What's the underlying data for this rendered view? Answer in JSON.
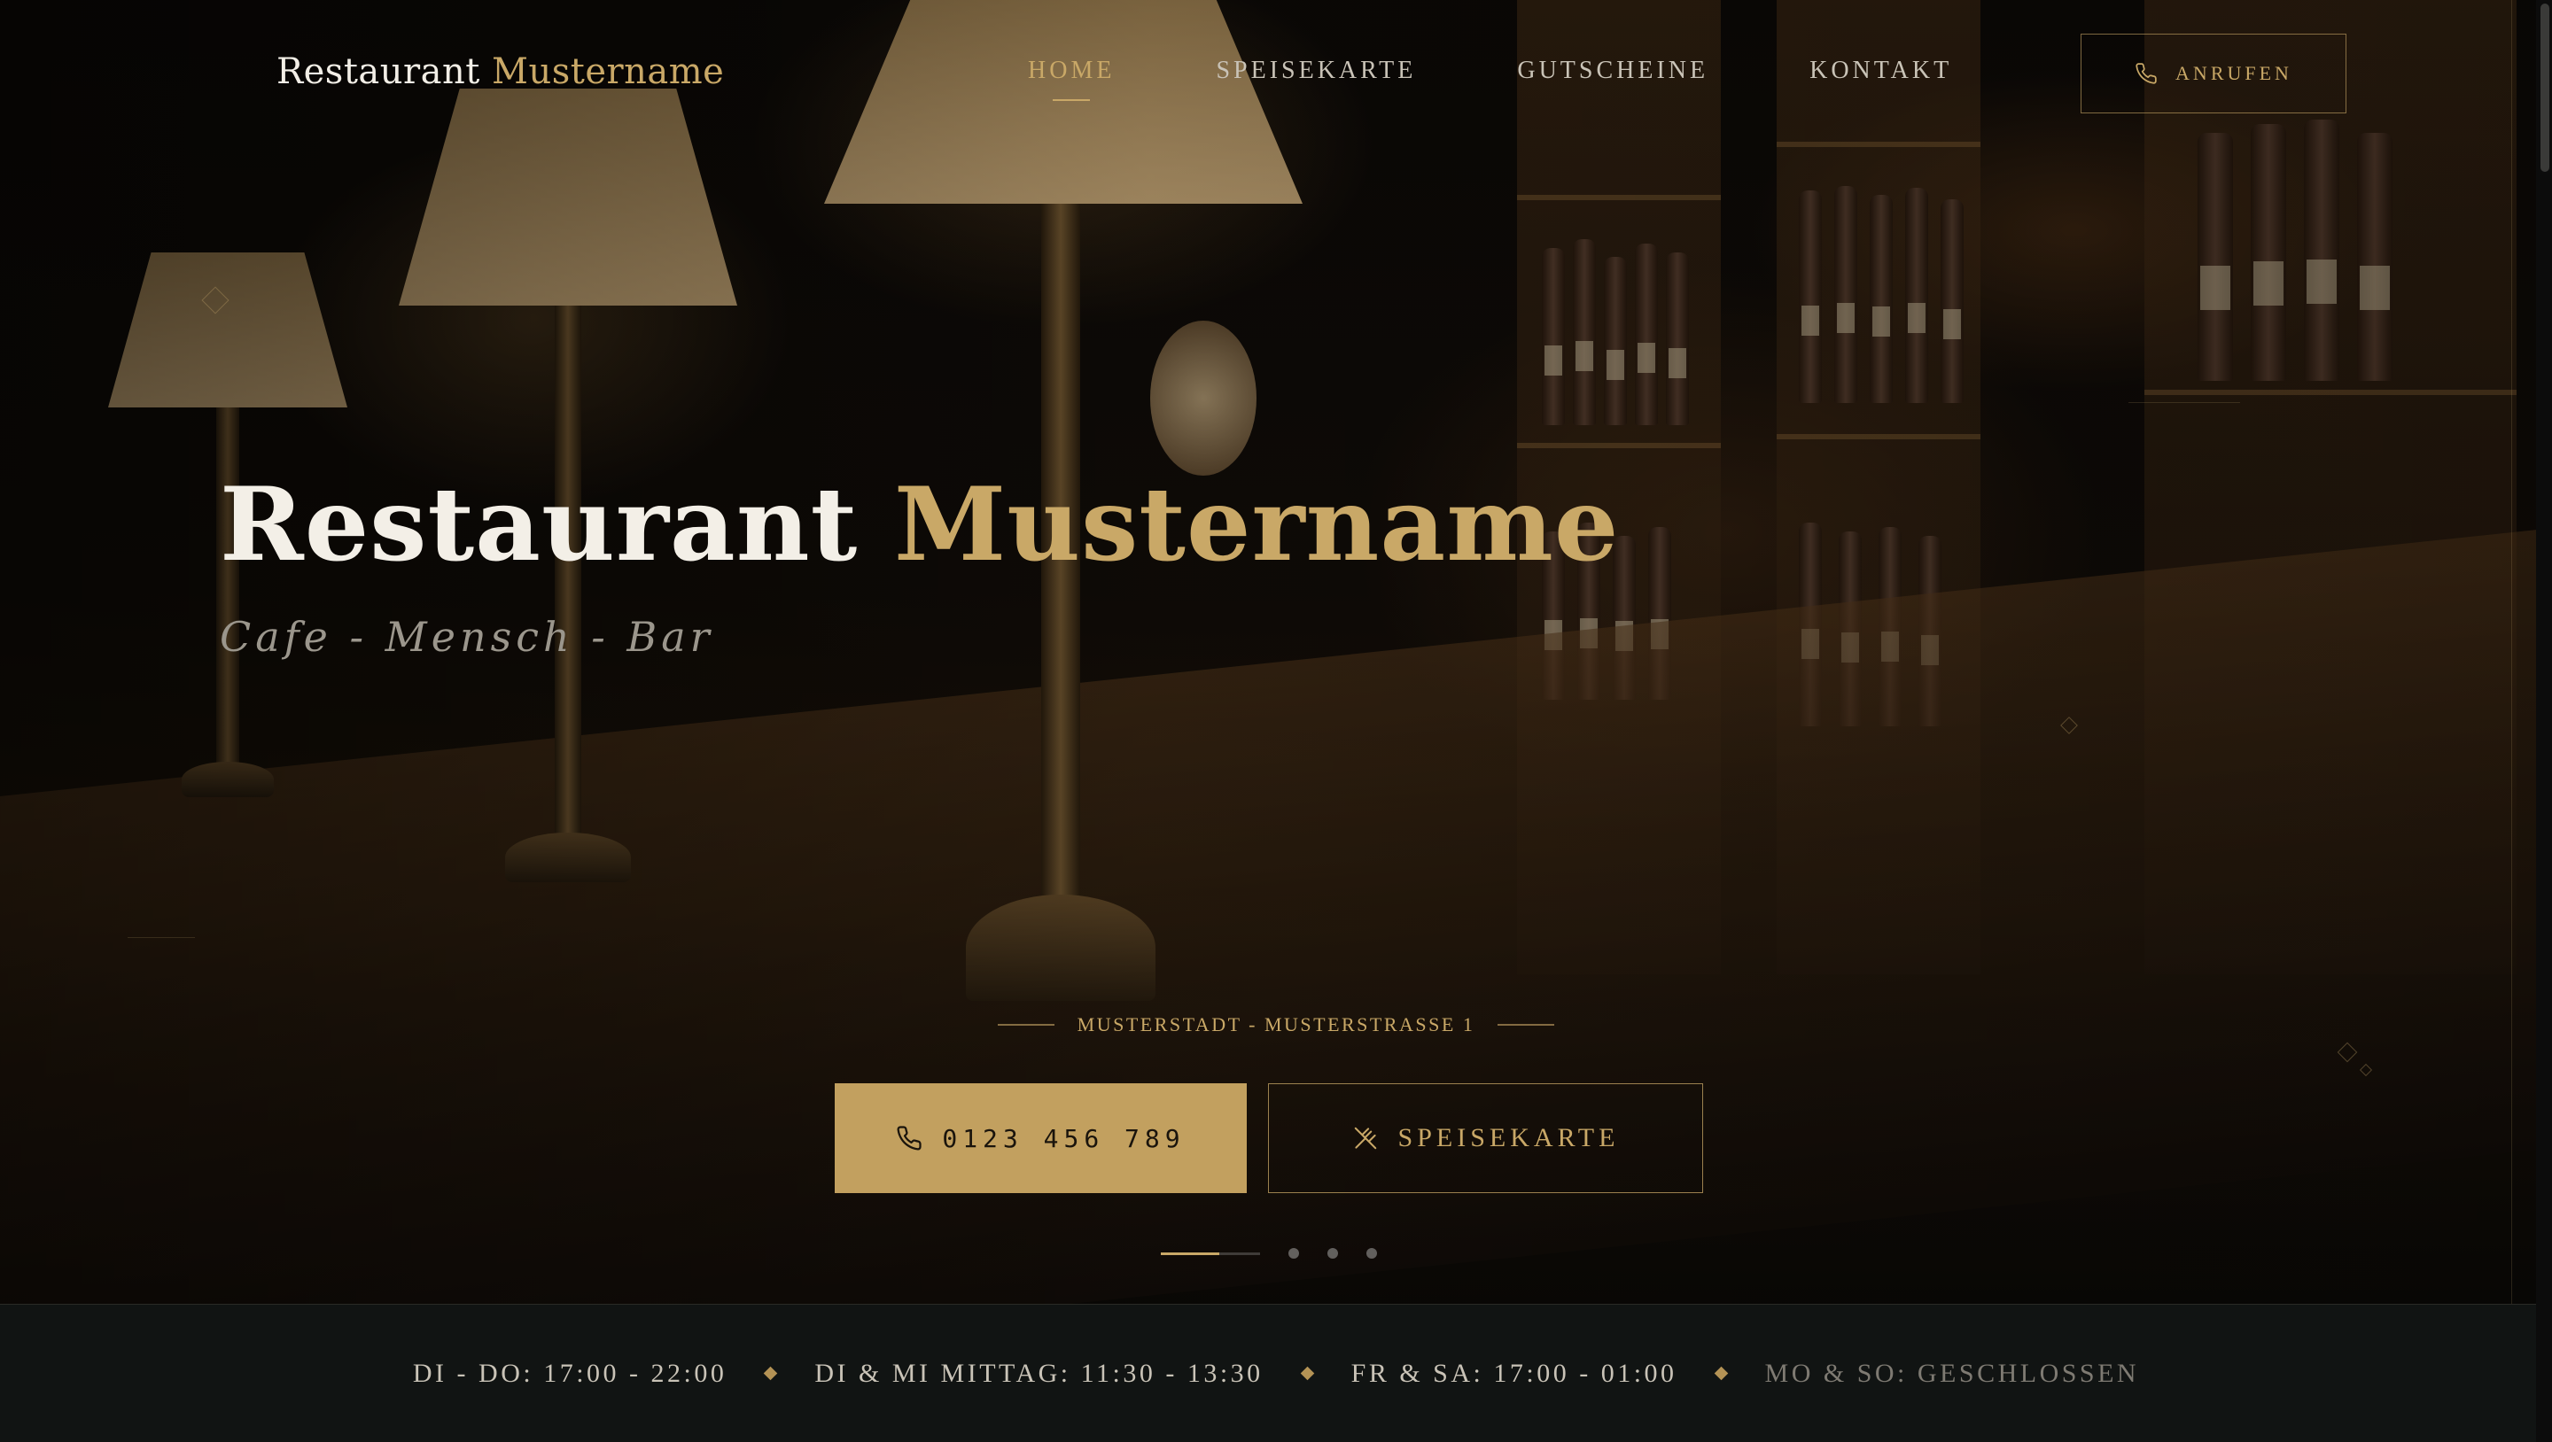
{
  "brand": {
    "name_part1": "Restaurant",
    "name_part2": "Mustername"
  },
  "nav": {
    "items": [
      {
        "label": "HOME",
        "active": true
      },
      {
        "label": "SPEISEKARTE",
        "active": false
      },
      {
        "label": "GUTSCHEINE",
        "active": false
      },
      {
        "label": "KONTAKT",
        "active": false
      }
    ],
    "call_label": "ANRUFEN"
  },
  "hero": {
    "title_part1": "Restaurant",
    "title_part2": "Mustername",
    "subtitle": "Cafe - Mensch - Bar",
    "address": "MUSTERSTADT - MUSTERSTRASSE 1",
    "phone_label": "0123 456 789",
    "menu_label": "SPEISEKARTE",
    "slides": {
      "count": 4,
      "active": 1
    }
  },
  "hours": [
    "DI - DO: 17:00 - 22:00",
    "DI & MI MITTAG: 11:30 - 13:30",
    "FR & SA: 17:00 - 01:00",
    "MO & SO: GESCHLOSSEN"
  ],
  "icons": {
    "phone": "phone-icon",
    "cutlery": "cutlery-icon"
  },
  "colors": {
    "accent": "#c9a867",
    "accent_fill": "#c2a05f",
    "background": "#070807",
    "strip": "#111413"
  }
}
